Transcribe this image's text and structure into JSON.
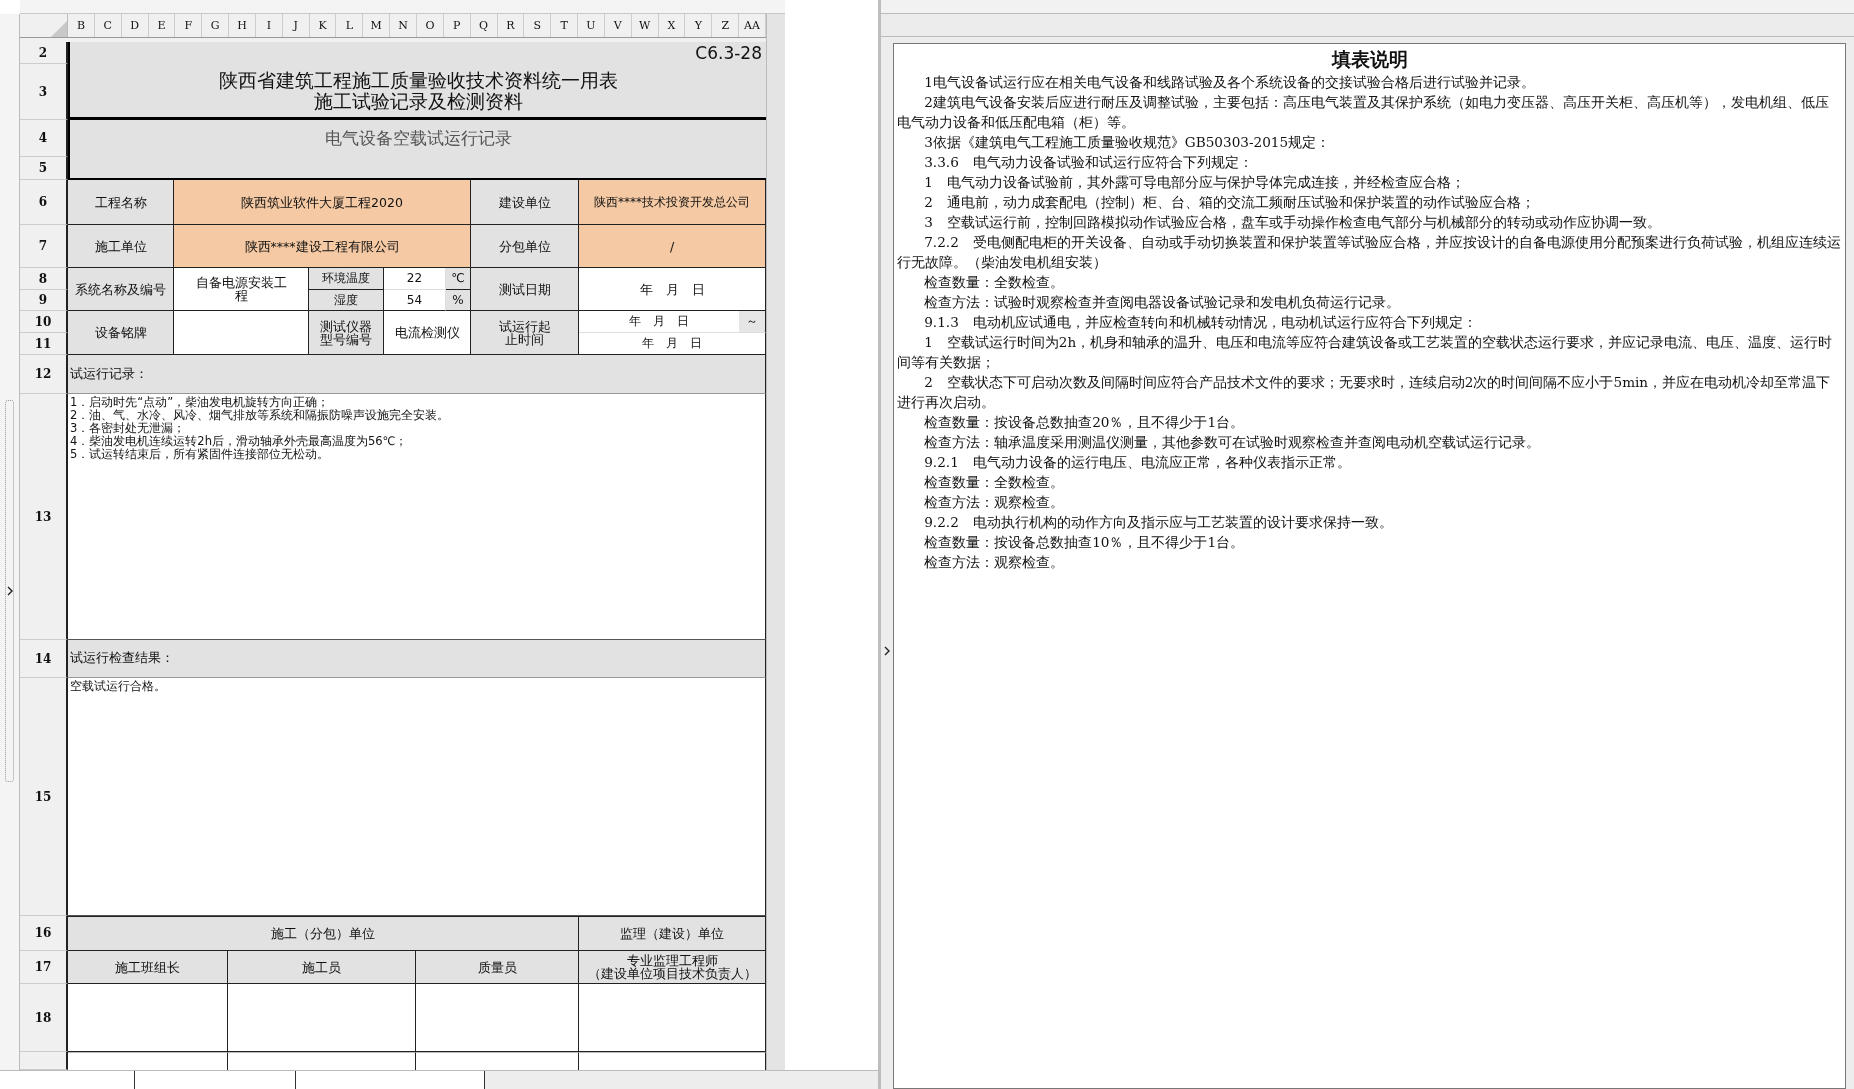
{
  "sheet": {
    "columns": [
      "B",
      "C",
      "D",
      "E",
      "F",
      "G",
      "H",
      "I",
      "J",
      "K",
      "L",
      "M",
      "N",
      "O",
      "P",
      "Q",
      "R",
      "S",
      "T",
      "U",
      "V",
      "W",
      "X",
      "Y",
      "Z",
      "AA"
    ],
    "row_numbers": [
      "2",
      "3",
      "4",
      "5",
      "6",
      "7",
      "8",
      "9",
      "10",
      "11",
      "12",
      "13",
      "14",
      "15",
      "16",
      "17",
      "18"
    ],
    "code": "C6.3-28",
    "title": [
      "陕西省建筑工程施工质量验收技术资料统一用表",
      "施工试验记录及检测资料"
    ],
    "record_name": "电气设备空载试运行记录",
    "fields": {
      "project_name_label": "工程名称",
      "project_name": "陕西筑业软件大厦工程2020",
      "builder_label": "建设单位",
      "builder": "陕西****技术投资开发总公司",
      "contractor_label": "施工单位",
      "contractor": "陕西****建设工程有限公司",
      "subcontractor_label": "分包单位",
      "subcontractor": "/",
      "system_label": "系统名称及编号",
      "system": "自备电源安装工程",
      "temperature_label": "环境温度",
      "temperature": "22",
      "temperature_unit": "℃",
      "humidity_label": "湿度",
      "humidity": "54",
      "humidity_unit": "%",
      "test_date_label": "测试日期",
      "test_date": "年　月　日",
      "nameplate_label": "设备铭牌",
      "instrument_label": "测试仪器型号编号",
      "instrument": "电流检测仪",
      "period_label": "试运行起止时间",
      "period_start": "年　月　日",
      "period_separator": "～",
      "period_end": "年　月　日"
    },
    "record_label": "试运行记录：",
    "record_lines": [
      "1．启动时先“点动”，柴油发电机旋转方向正确；",
      "2．油、气、水冷、风冷、烟气排放等系统和隔振防噪声设施完全安装。",
      "3．各密封处无泄漏；",
      "4．柴油发电机连续运转2h后，滑动轴承外壳最高温度为56℃；",
      "5．试运转结束后，所有紧固件连接部位无松动。"
    ],
    "result_label": "试运行检查结果：",
    "result": "空载试运行合格。",
    "signatures": {
      "contractor_unit": "施工（分包）单位",
      "supervisor_unit": "监理（建设）单位",
      "roles": [
        [
          "施工班组长"
        ],
        [
          "施工员"
        ],
        [
          "质量员"
        ],
        [
          "专业监理工程师",
          "（建设单位项目技术负责人）"
        ]
      ]
    }
  },
  "instructions": {
    "title": "填表说明",
    "paragraphs": [
      "1电气设备试运行应在相关电气设备和线路试验及各个系统设备的交接试验合格后进行试验并记录。",
      "2建筑电气设备安装后应进行耐压及调整试验，主要包括：高压电气装置及其保护系统（如电力变压器、高压开关柜、高压机等），发电机组、低压电气动力设备和低压配电箱（柜）等。",
      "3依据《建筑电气工程施工质量验收规范》GB50303-2015规定：",
      "3.3.6　电气动力设备试验和试运行应符合下列规定：",
      "1　电气动力设备试验前，其外露可导电部分应与保护导体完成连接，并经检查应合格；",
      "2　通电前，动力成套配电（控制）柜、台、箱的交流工频耐压试验和保护装置的动作试验应合格；",
      "3　空载试运行前，控制回路模拟动作试验应合格，盘车或手动操作检查电气部分与机械部分的转动或动作应协调一致。",
      "7.2.2　受电侧配电柜的开关设备、自动或手动切换装置和保护装置等试验应合格，并应按设计的自备电源使用分配预案进行负荷试验，机组应连续运行无故障。（柴油发电机组安装）",
      "检查数量：全数检查。",
      "检查方法：试验时观察检查并查阅电器设备试验记录和发电机负荷运行记录。",
      "9.1.3　电动机应试通电，并应检查转向和机械转动情况，电动机试运行应符合下列规定：",
      "1　空载试运行时间为2h，机身和轴承的温升、电压和电流等应符合建筑设备或工艺装置的空载状态运行要求，并应记录电流、电压、温度、运行时间等有关数据；",
      "2　空载状态下可启动次数及间隔时间应符合产品技术文件的要求；无要求时，连续启动2次的时间间隔不应小于5min，并应在电动机冷却至常温下进行再次启动。",
      "检查数量：按设备总数抽查20％，且不得少于1台。",
      "检查方法：轴承温度采用测温仪测量，其他参数可在试验时观察检查并查阅电动机空载试运行记录。",
      "9.2.1　电气动力设备的运行电压、电流应正常，各种仪表指示正常。",
      "检查数量：全数检查。",
      "检查方法：观察检查。",
      "9.2.2　电动执行机构的动作方向及指示应与工艺装置的设计要求保持一致。",
      "检查数量：按设备总数抽查10％，且不得少于1台。",
      "检查方法：观察检查。"
    ]
  }
}
